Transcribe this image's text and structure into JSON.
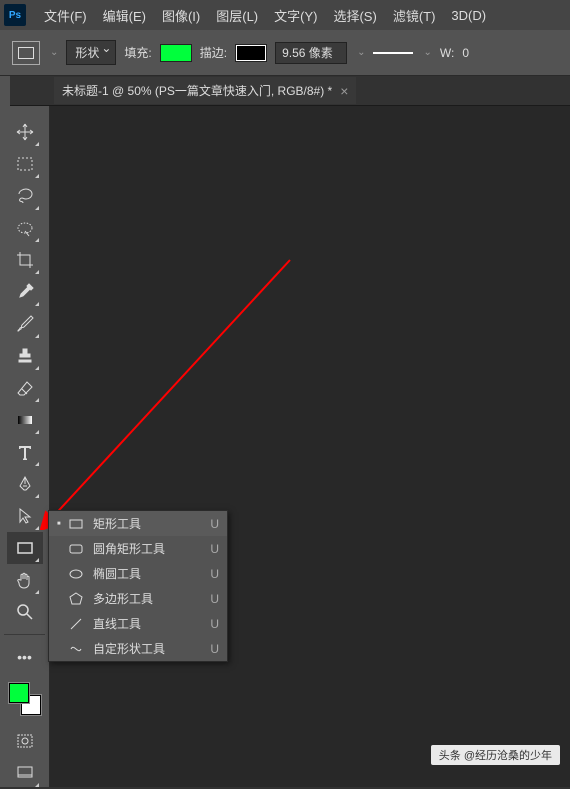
{
  "logo": "Ps",
  "menu": [
    "文件(F)",
    "编辑(E)",
    "图像(I)",
    "图层(L)",
    "文字(Y)",
    "选择(S)",
    "滤镜(T)",
    "3D(D)"
  ],
  "options": {
    "mode": "形状",
    "fill_label": "填充:",
    "stroke_label": "描边:",
    "stroke_width": "9.56 像素",
    "w_label": "W:",
    "w_value": "0"
  },
  "tab": {
    "title": "未标题-1 @ 50% (PS一篇文章快速入门, RGB/8#) *"
  },
  "flyout": {
    "items": [
      {
        "label": "矩形工具",
        "key": "U",
        "icon": "rect",
        "selected": true
      },
      {
        "label": "圆角矩形工具",
        "key": "U",
        "icon": "roundrect"
      },
      {
        "label": "椭圆工具",
        "key": "U",
        "icon": "ellipse"
      },
      {
        "label": "多边形工具",
        "key": "U",
        "icon": "polygon"
      },
      {
        "label": "直线工具",
        "key": "U",
        "icon": "line"
      },
      {
        "label": "自定形状工具",
        "key": "U",
        "icon": "custom"
      }
    ]
  },
  "watermark": {
    "prefix": "头条",
    "author": "@经历沧桑的少年"
  },
  "colors": {
    "foreground": "#00ff3c",
    "background": "#ffffff"
  }
}
